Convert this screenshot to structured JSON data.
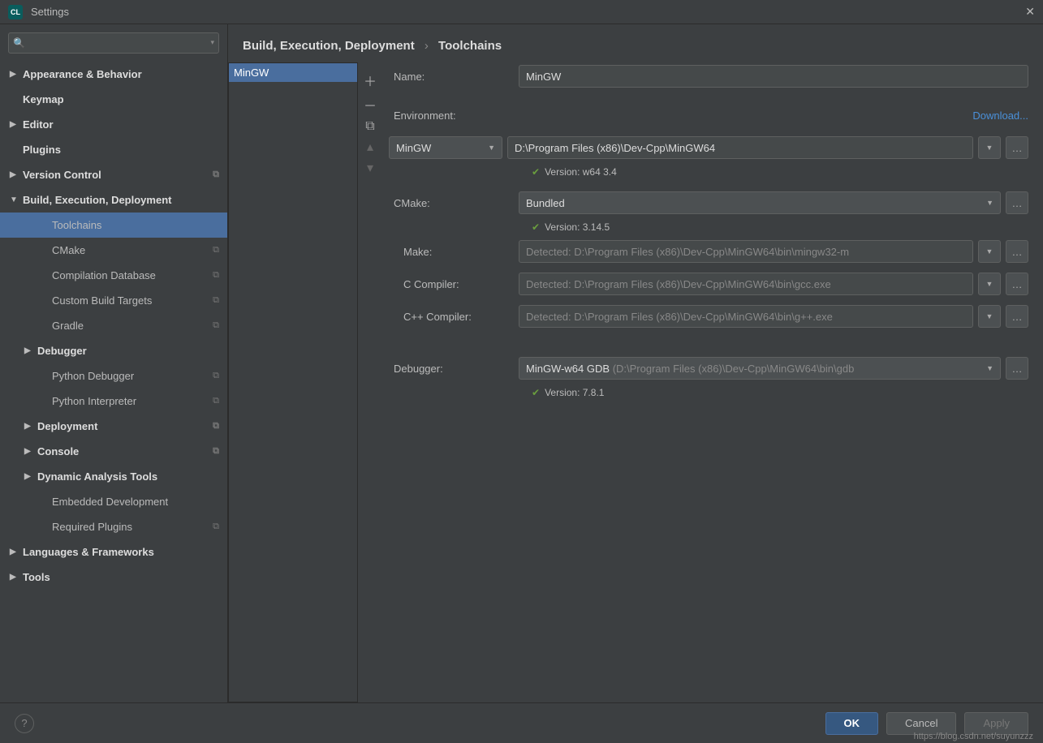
{
  "window": {
    "title": "Settings"
  },
  "search": {
    "placeholder": ""
  },
  "tree": [
    {
      "label": "Appearance & Behavior",
      "level": "top",
      "arrow": "▶"
    },
    {
      "label": "Keymap",
      "level": "top"
    },
    {
      "label": "Editor",
      "level": "top",
      "arrow": "▶"
    },
    {
      "label": "Plugins",
      "level": "top"
    },
    {
      "label": "Version Control",
      "level": "top",
      "arrow": "▶",
      "copy": true
    },
    {
      "label": "Build, Execution, Deployment",
      "level": "top",
      "arrow": "▼",
      "bold": true
    },
    {
      "label": "Toolchains",
      "level": "sub2",
      "selected": true
    },
    {
      "label": "CMake",
      "level": "sub2",
      "copy": true
    },
    {
      "label": "Compilation Database",
      "level": "sub2",
      "copy": true
    },
    {
      "label": "Custom Build Targets",
      "level": "sub2",
      "copy": true
    },
    {
      "label": "Gradle",
      "level": "sub2",
      "copy": true
    },
    {
      "label": "Debugger",
      "level": "sub",
      "arrow": "▶",
      "bold": true
    },
    {
      "label": "Python Debugger",
      "level": "sub2",
      "copy": true
    },
    {
      "label": "Python Interpreter",
      "level": "sub2",
      "copy": true
    },
    {
      "label": "Deployment",
      "level": "sub",
      "arrow": "▶",
      "bold": true,
      "copy": true
    },
    {
      "label": "Console",
      "level": "sub",
      "arrow": "▶",
      "bold": true,
      "copy": true
    },
    {
      "label": "Dynamic Analysis Tools",
      "level": "sub",
      "arrow": "▶",
      "bold": true
    },
    {
      "label": "Embedded Development",
      "level": "sub2"
    },
    {
      "label": "Required Plugins",
      "level": "sub2",
      "copy": true
    },
    {
      "label": "Languages & Frameworks",
      "level": "top",
      "arrow": "▶"
    },
    {
      "label": "Tools",
      "level": "top",
      "arrow": "▶"
    }
  ],
  "breadcrumb": {
    "root": "Build, Execution, Deployment",
    "leaf": "Toolchains"
  },
  "list": {
    "items": [
      "MinGW"
    ],
    "selected": 0
  },
  "form": {
    "name_label": "Name:",
    "name_value": "MinGW",
    "env_label": "Environment:",
    "download": "Download...",
    "env_type": "MinGW",
    "env_path": "D:\\Program Files (x86)\\Dev-Cpp\\MinGW64",
    "env_version": "Version: w64 3.4",
    "cmake_label": "CMake:",
    "cmake_value": "Bundled",
    "cmake_version": "Version: 3.14.5",
    "make_label": "Make:",
    "make_value": "Detected: D:\\Program Files (x86)\\Dev-Cpp\\MinGW64\\bin\\mingw32-m",
    "cc_label": "C Compiler:",
    "cc_value": "Detected: D:\\Program Files (x86)\\Dev-Cpp\\MinGW64\\bin\\gcc.exe",
    "cxx_label": "C++ Compiler:",
    "cxx_value": "Detected: D:\\Program Files (x86)\\Dev-Cpp\\MinGW64\\bin\\g++.exe",
    "dbg_label": "Debugger:",
    "dbg_value": "MinGW-w64 GDB",
    "dbg_path": "(D:\\Program Files (x86)\\Dev-Cpp\\MinGW64\\bin\\gdb",
    "dbg_version": "Version: 7.8.1"
  },
  "footer": {
    "ok": "OK",
    "cancel": "Cancel",
    "apply": "Apply"
  },
  "watermark": "https://blog.csdn.net/suyunzzz"
}
